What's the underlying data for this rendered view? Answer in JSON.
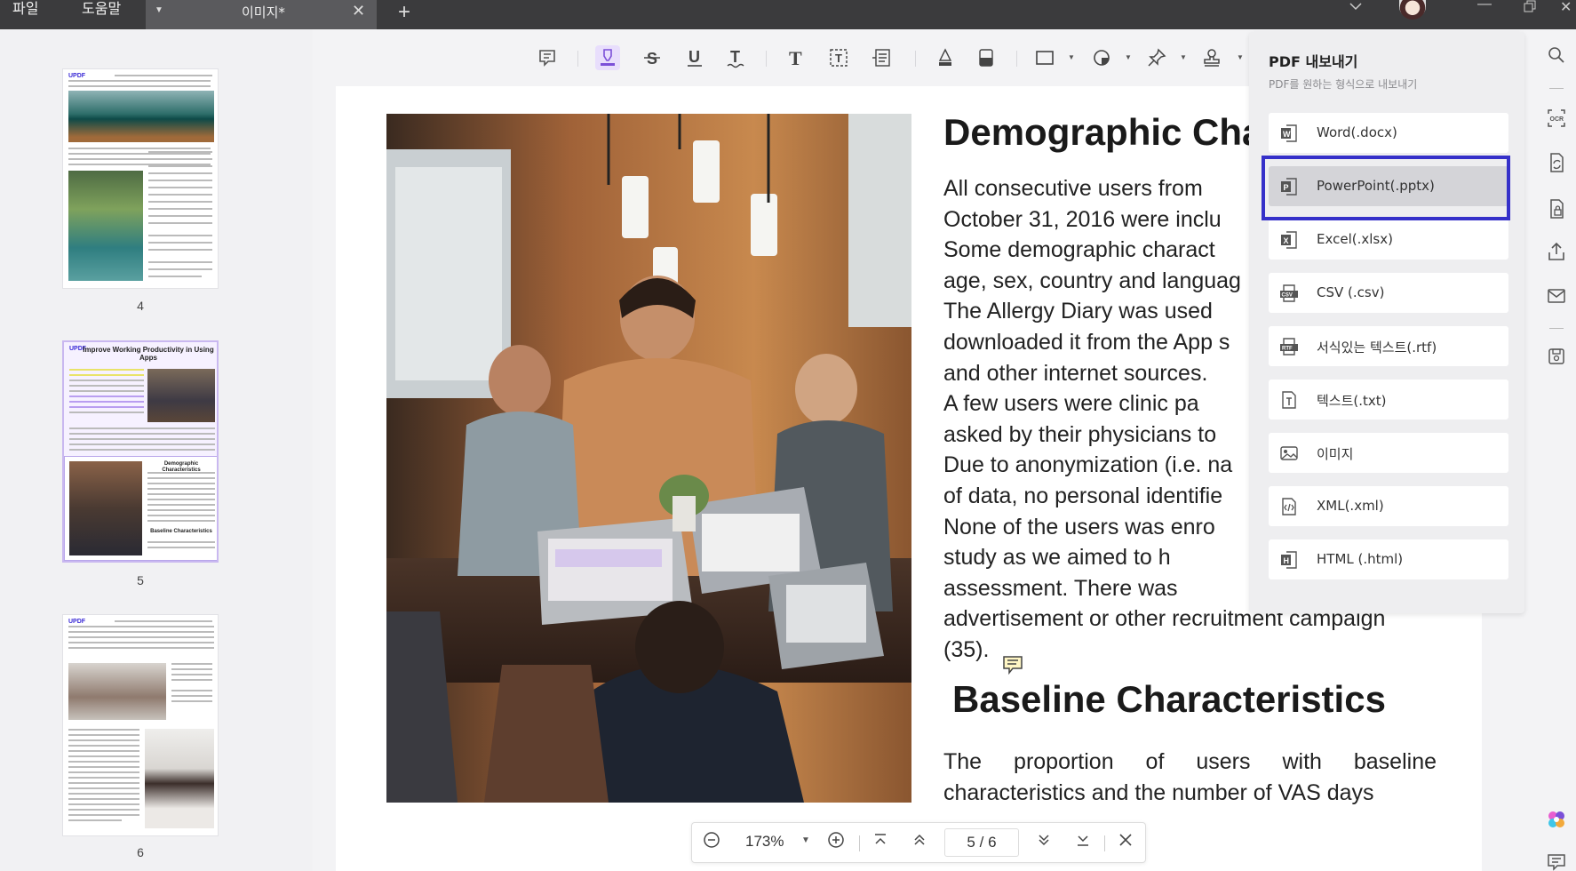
{
  "menu": {
    "file": "파일",
    "help": "도움말"
  },
  "tab": {
    "title": "이미지*"
  },
  "thumbnails": [
    {
      "page": "4"
    },
    {
      "page": "5",
      "title": "Improve Working Productivity in Using Apps",
      "subtitle1": "Demographic Characteristics",
      "subtitle2": "Baseline Characteristics"
    },
    {
      "page": "6"
    }
  ],
  "thumb_logo": "UPDF",
  "doc": {
    "title": "Demographic Cha",
    "body_lines": [
      "All consecutive users from",
      "October 31, 2016 were inclu",
      "Some demographic charact",
      "age, sex, country and languag",
      "The Allergy Diary was used",
      "downloaded it from the App s",
      "and other internet sources.",
      "A few users were clinic pa",
      "asked by their physicians to",
      "Due to anonymization (i.e. na",
      "of data, no personal identifie",
      "None of the users was enro",
      "study as we aimed to h",
      "assessment. There was",
      "advertisement or other recruitment campaign",
      "(35)."
    ],
    "heading2": "Baseline Characteristics",
    "body2_lines": [
      "The proportion of users with baseline",
      "characteristics and the number of VAS days"
    ]
  },
  "navbar": {
    "zoom": "173%",
    "page_current": "5",
    "page_sep": "/",
    "page_total": "6"
  },
  "export": {
    "title": "PDF 내보내기",
    "subtitle": "PDF를 원하는 형식으로 내보내기",
    "items": [
      {
        "label": "Word(.docx)",
        "icon": "word-icon"
      },
      {
        "label": "PowerPoint(.pptx)",
        "icon": "powerpoint-icon"
      },
      {
        "label": "Excel(.xlsx)",
        "icon": "excel-icon"
      },
      {
        "label": "CSV (.csv)",
        "icon": "csv-icon"
      },
      {
        "label": "서식있는 텍스트(.rtf)",
        "icon": "rtf-icon"
      },
      {
        "label": "텍스트(.txt)",
        "icon": "txt-icon"
      },
      {
        "label": "이미지",
        "icon": "image-icon"
      },
      {
        "label": "XML(.xml)",
        "icon": "xml-icon"
      },
      {
        "label": "HTML (.html)",
        "icon": "html-icon"
      }
    ],
    "selected_index": 1,
    "highlight_color": "#3530c9"
  },
  "colors": {
    "accent": "#7b4fd8",
    "titlebar": "#3b3b3d"
  }
}
